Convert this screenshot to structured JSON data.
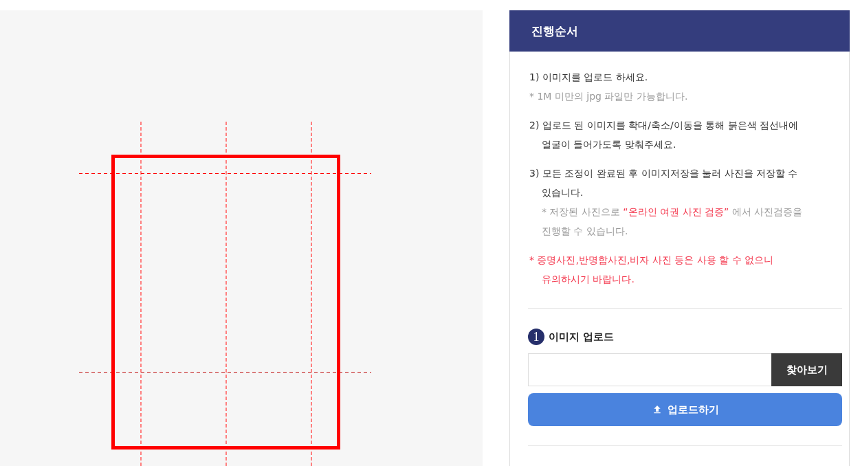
{
  "panel": {
    "title": "진행순서",
    "instructions": [
      {
        "kind": "step",
        "text": "1) 이미지를 업로드 하세요."
      },
      {
        "kind": "note",
        "text": "* 1M 미만의 jpg 파일만 가능합니다."
      },
      {
        "kind": "step",
        "text": "2) 업로드 된 이미지를 확대/축소/이동을 통해 붉은색 점선내에 얼굴이 들어가도록 맞춰주세요."
      },
      {
        "kind": "step",
        "text": "3) 모든 조정이 완료된 후 이미지저장을 눌러 사진을 저장할 수 있습니다.",
        "note": [
          {
            "kind": "plain",
            "text": "* 저장된 사진으로 "
          },
          {
            "kind": "emphasis",
            "text": "“온라인 여권 사진 검증”"
          },
          {
            "kind": "plain",
            "text": " 에서 사진검증을 진행할 수 있습니다."
          }
        ]
      },
      {
        "kind": "warning",
        "text": "* 증명사진,반명함사진,비자 사진 등은 사용 할 수 없으니 유의하시기 바랍니다."
      }
    ],
    "upload": {
      "step_number": "1",
      "label": "이미지 업로드",
      "browse_button": "찾아보기",
      "upload_button": "업로드하기"
    }
  }
}
